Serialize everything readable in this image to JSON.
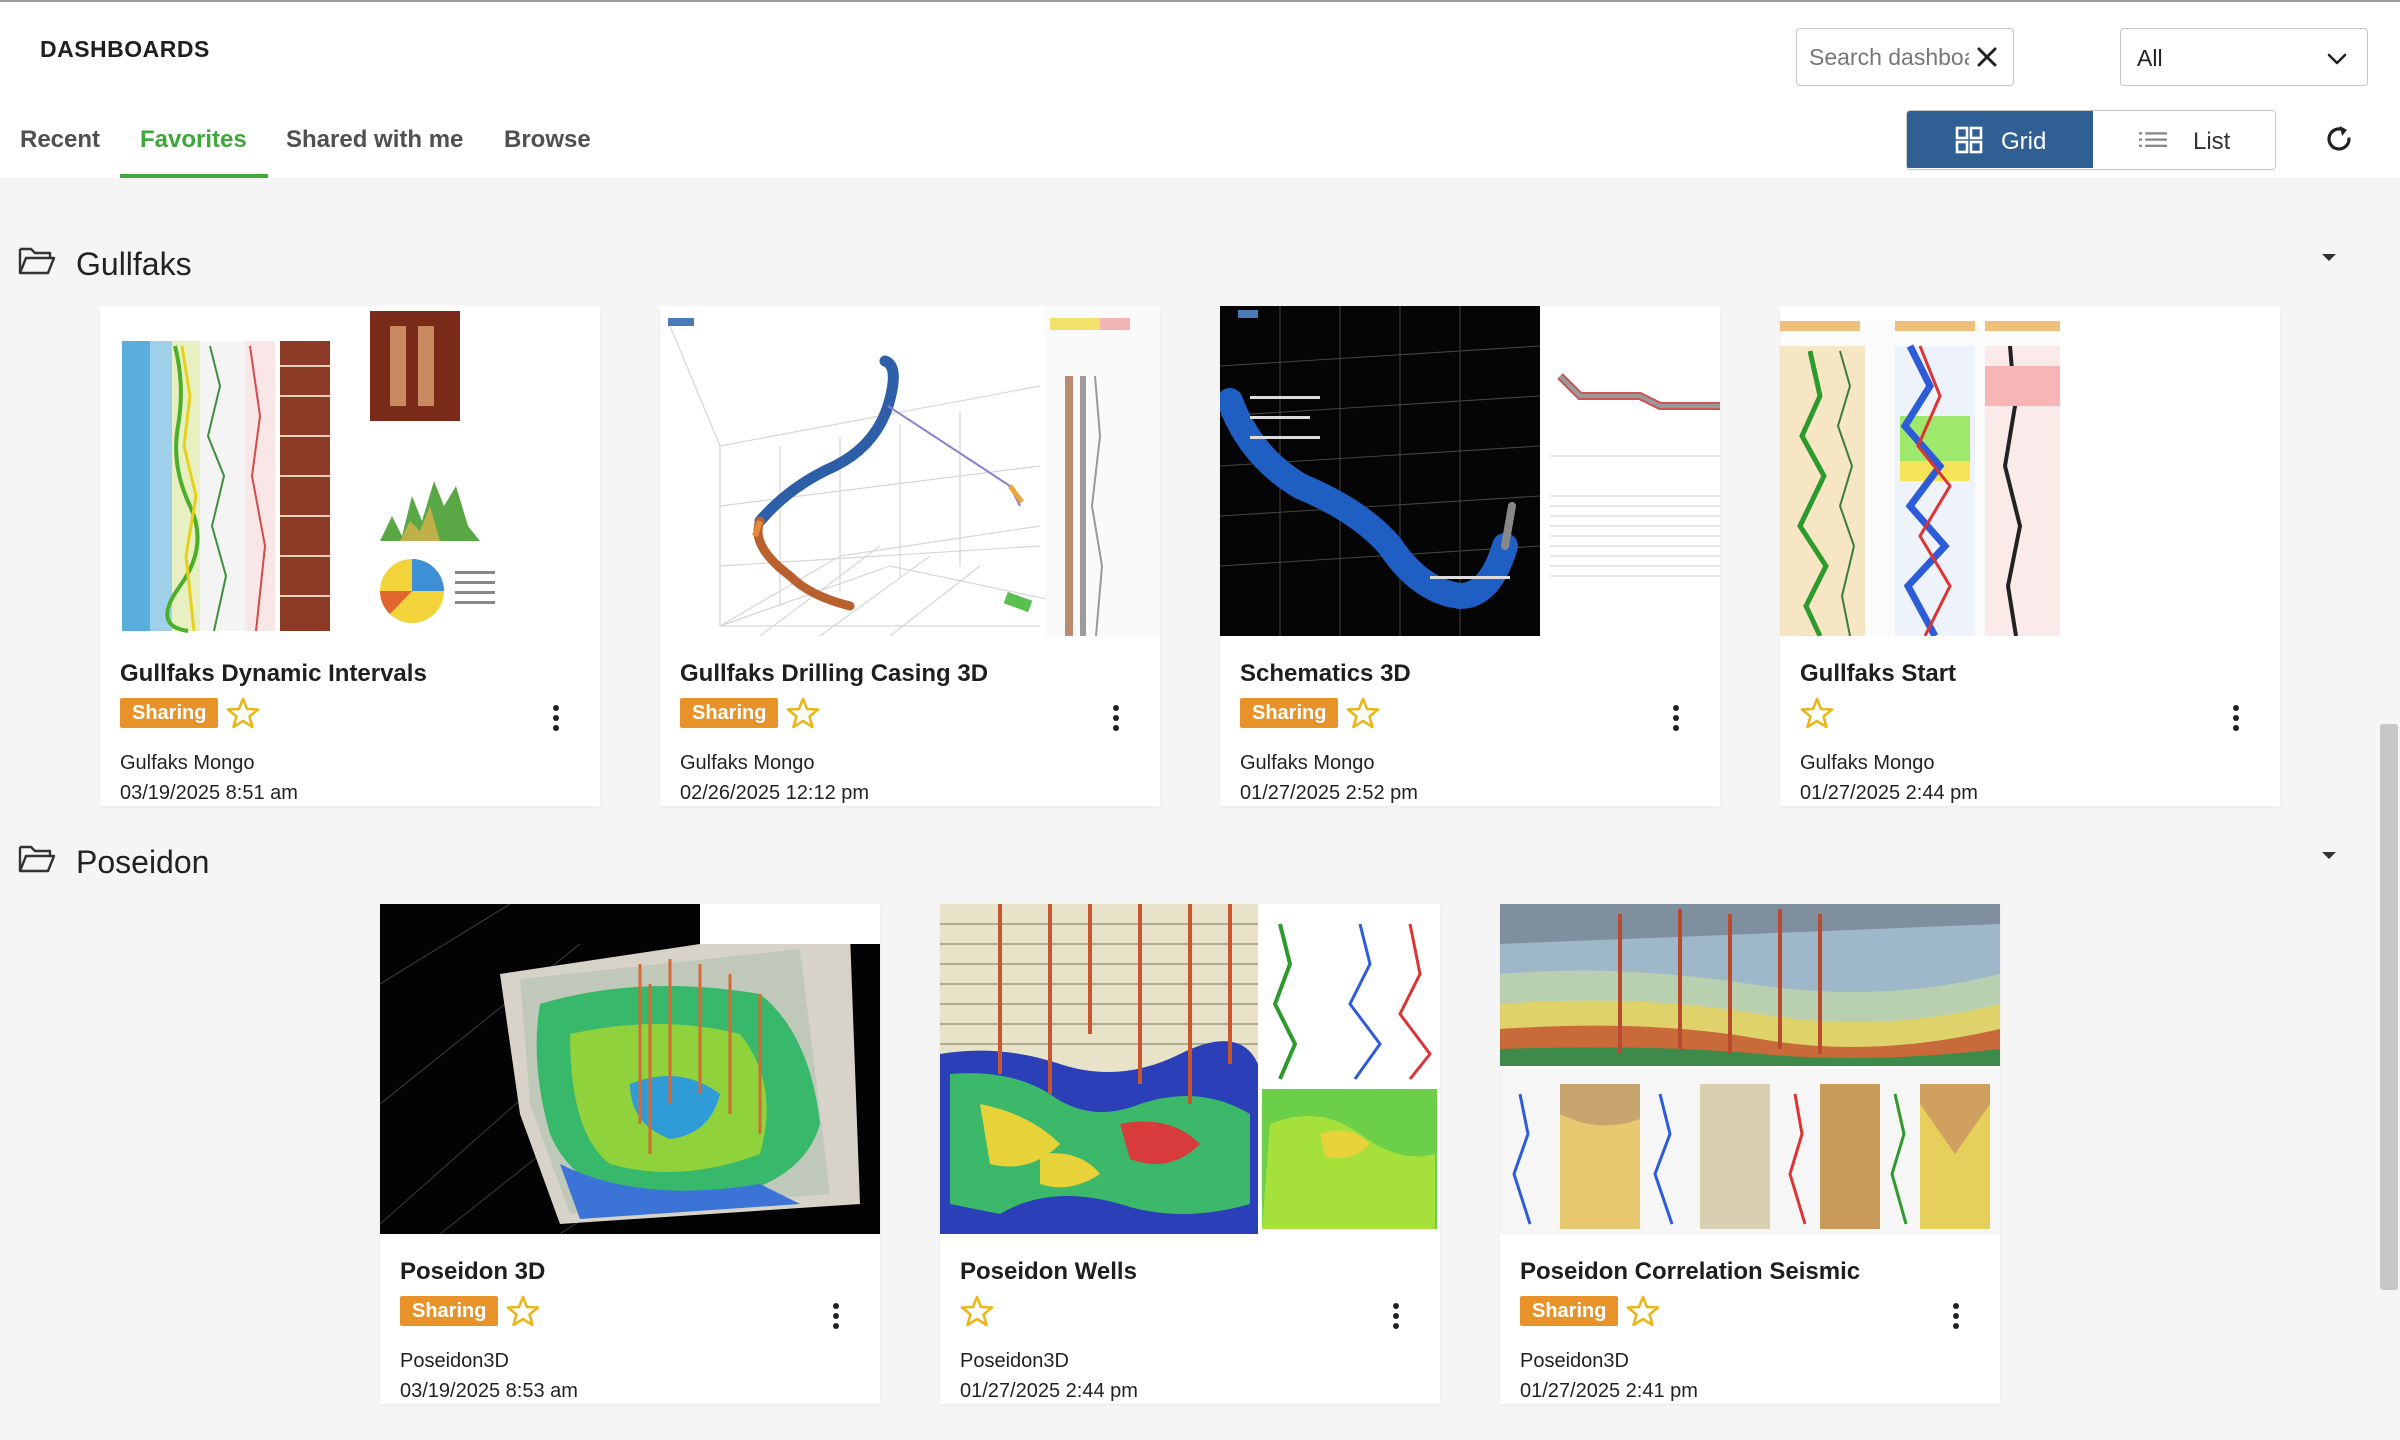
{
  "header": {
    "title": "DASHBOARDS",
    "search": {
      "placeholder": "Search dashboard",
      "value": ""
    },
    "filter": {
      "selected": "All"
    },
    "tabs": [
      {
        "label": "Recent"
      },
      {
        "label": "Favorites",
        "active": true
      },
      {
        "label": "Shared with me"
      },
      {
        "label": "Browse"
      }
    ],
    "view": {
      "grid_label": "Grid",
      "list_label": "List",
      "selected": "Grid"
    }
  },
  "sections": [
    {
      "name": "Gullfaks",
      "cards": [
        {
          "title": "Gullfaks Dynamic Intervals",
          "badge": "Sharing",
          "owner": "Gulfaks Mongo",
          "date": "03/19/2025 8:51 am",
          "icon": "star-icon"
        },
        {
          "title": "Gullfaks Drilling Casing 3D",
          "badge": "Sharing",
          "owner": "Gulfaks Mongo",
          "date": "02/26/2025 12:12 pm",
          "icon": "star-icon"
        },
        {
          "title": "Schematics 3D",
          "badge": "Sharing",
          "owner": "Gulfaks Mongo",
          "date": "01/27/2025 2:52 pm",
          "icon": "star-icon"
        },
        {
          "title": "Gullfaks Start",
          "badge": "",
          "owner": "Gulfaks Mongo",
          "date": "01/27/2025 2:44 pm",
          "icon": "star-icon"
        }
      ]
    },
    {
      "name": "Poseidon",
      "cards": [
        {
          "title": "Poseidon 3D",
          "badge": "Sharing",
          "owner": "Poseidon3D",
          "date": "03/19/2025 8:53 am",
          "icon": "star-icon"
        },
        {
          "title": "Poseidon Wells",
          "badge": "",
          "owner": "Poseidon3D",
          "date": "01/27/2025 2:44 pm",
          "icon": "star-icon"
        },
        {
          "title": "Poseidon Correlation Seismic",
          "badge": "Sharing",
          "owner": "Poseidon3D",
          "date": "01/27/2025 2:41 pm",
          "icon": "star-icon"
        }
      ]
    }
  ],
  "colors": {
    "accent_green": "#3fa83a",
    "grid_active": "#2f5f93",
    "sharing_badge": "#e8932a",
    "star": "#e9b61c"
  }
}
